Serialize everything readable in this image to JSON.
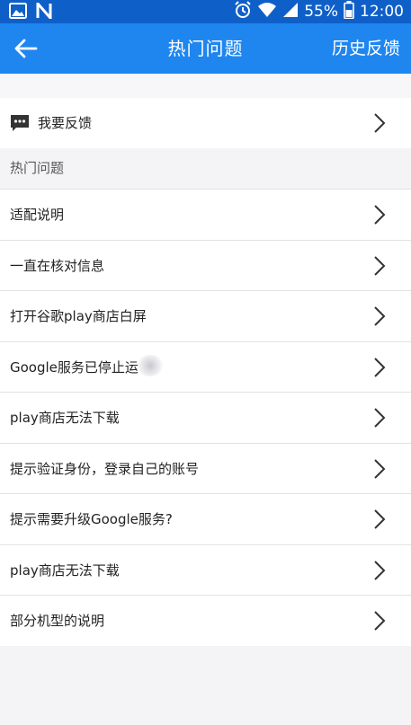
{
  "statusbar": {
    "battery": "55%",
    "time": "12:00",
    "icons": [
      "image-icon",
      "n-logo-icon",
      "alarm-icon",
      "wifi-icon",
      "signal-icon",
      "battery-icon"
    ]
  },
  "appbar": {
    "title": "热门问题",
    "history_label": "历史反馈",
    "back_icon": "arrow-left-icon"
  },
  "feedback": {
    "label": "我要反馈",
    "icon": "chat-bubble-icon"
  },
  "section": {
    "label": "热门问题"
  },
  "list": {
    "items": [
      {
        "label": "适配说明"
      },
      {
        "label": "一直在核对信息"
      },
      {
        "label": "打开谷歌play商店白屏"
      },
      {
        "label": "Google服务已停止运"
      },
      {
        "label": "play商店无法下载"
      },
      {
        "label": "提示验证身份，登录自己的账号"
      },
      {
        "label": "提示需要升级Google服务?"
      },
      {
        "label": "play商店无法下载"
      },
      {
        "label": "部分机型的说明"
      }
    ]
  },
  "colors": {
    "statusbar": "#0f5fc8",
    "appbar": "#1f86f0",
    "background": "#f4f4f6"
  }
}
